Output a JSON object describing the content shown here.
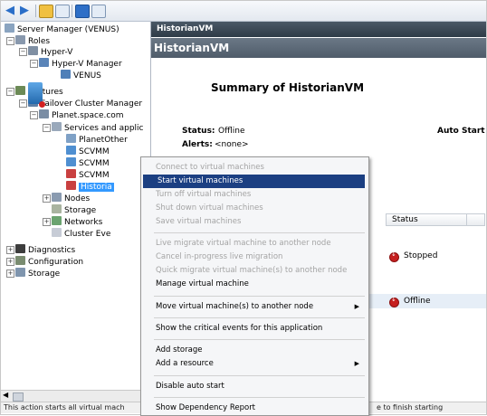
{
  "colors": {
    "selection": "#3399ff",
    "menu_highlight": "#1b3f82",
    "header_dark": "#2f3b47",
    "status_red": "#c62020"
  },
  "tree": {
    "root": "Server Manager (VENUS)",
    "roles": "Roles",
    "hyperv": "Hyper-V",
    "hyperv_manager": "Hyper-V Manager",
    "venus": "VENUS",
    "features": "Features",
    "fcm": "Failover Cluster Manager",
    "cluster": "Planet.space.com",
    "services": "Services and applic",
    "planetother": "PlanetOther",
    "scvmm1": "SCVMM",
    "scvmm2": "SCVMM",
    "scvmm3": "SCVMM",
    "historian": "Historia",
    "nodes": "Nodes",
    "storage": "Storage",
    "networks": "Networks",
    "cluster_events": "Cluster Eve",
    "diagnostics": "Diagnostics",
    "configuration": "Configuration",
    "storage2": "Storage"
  },
  "right": {
    "window_title": "HistorianVM",
    "header": "HistorianVM",
    "summary_title": "Summary of HistorianVM",
    "status_label": "Status:",
    "status_value": "Offline",
    "alerts_label": "Alerts:",
    "alerts_value": "<none>",
    "auto_start_label": "Auto Start",
    "col_status": "Status",
    "row1_status": "Stopped",
    "row2_status": "Offline"
  },
  "menu": {
    "connect": "Connect to virtual machines",
    "start": "Start virtual machines",
    "turn_off": "Turn off virtual machines",
    "shut_down": "Shut down virtual machines",
    "save": "Save virtual machines",
    "live_migrate": "Live migrate virtual machine to another node",
    "cancel_live": "Cancel in-progress live migration",
    "quick_migrate": "Quick migrate virtual machine(s) to another node",
    "manage_vm": "Manage virtual machine",
    "move_vm": "Move virtual machine(s) to another node",
    "show_critical": "Show the critical events for this application",
    "add_storage": "Add storage",
    "add_resource": "Add a resource",
    "disable_auto": "Disable auto start",
    "show_dependency": "Show Dependency Report"
  },
  "statusbar": {
    "left": "This action starts all virtual mach",
    "right": "e to finish starting"
  }
}
